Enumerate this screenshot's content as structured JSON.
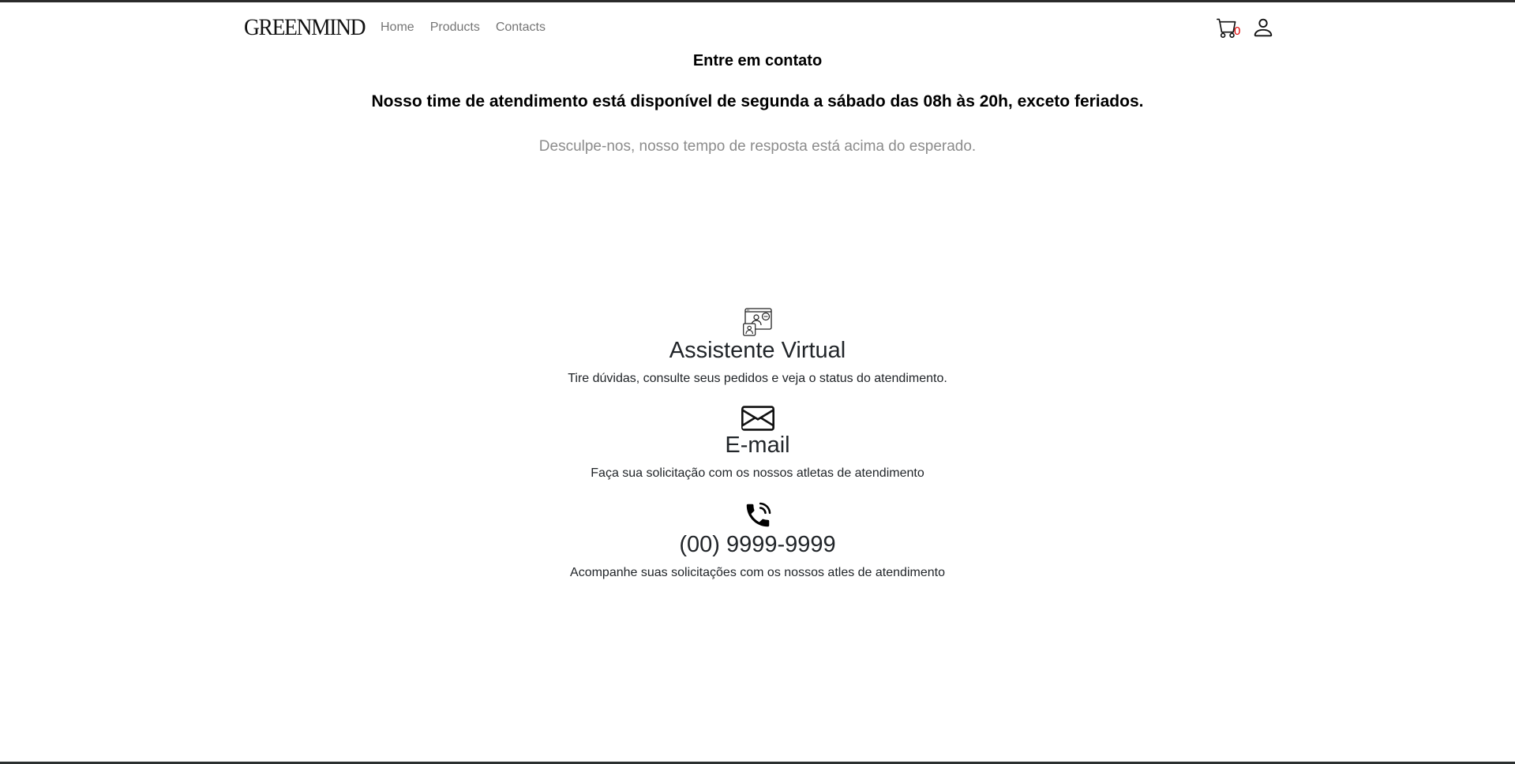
{
  "brand": {
    "name": "GREENMIND"
  },
  "nav": {
    "links": [
      {
        "label": "Home"
      },
      {
        "label": "Products"
      },
      {
        "label": "Contacts"
      }
    ]
  },
  "cart": {
    "count": "0",
    "icon": "cart-icon",
    "count_color": "#e00000"
  },
  "user": {
    "icon": "user-icon"
  },
  "contact": {
    "title": "Entre em contato",
    "hours": "Nosso time de atendimento está disponível de segunda a sábado das 08h às 20h, exceto feriados.",
    "notice": "Desculpe-nos, nosso tempo de resposta está acima do esperado."
  },
  "channels": [
    {
      "icon": "video-call-icon",
      "title": "Assistente Virtual",
      "description": "Tire dúvidas, consulte seus pedidos e veja o status do atendimento."
    },
    {
      "icon": "envelope-icon",
      "title": "E-mail",
      "description": "Faça sua solicitação com os nossos atletas de atendimento"
    },
    {
      "icon": "phone-icon",
      "title": "(00) 9999-9999",
      "description": "Acompanhe suas solicitações com os nossos atles de atendimento"
    }
  ]
}
